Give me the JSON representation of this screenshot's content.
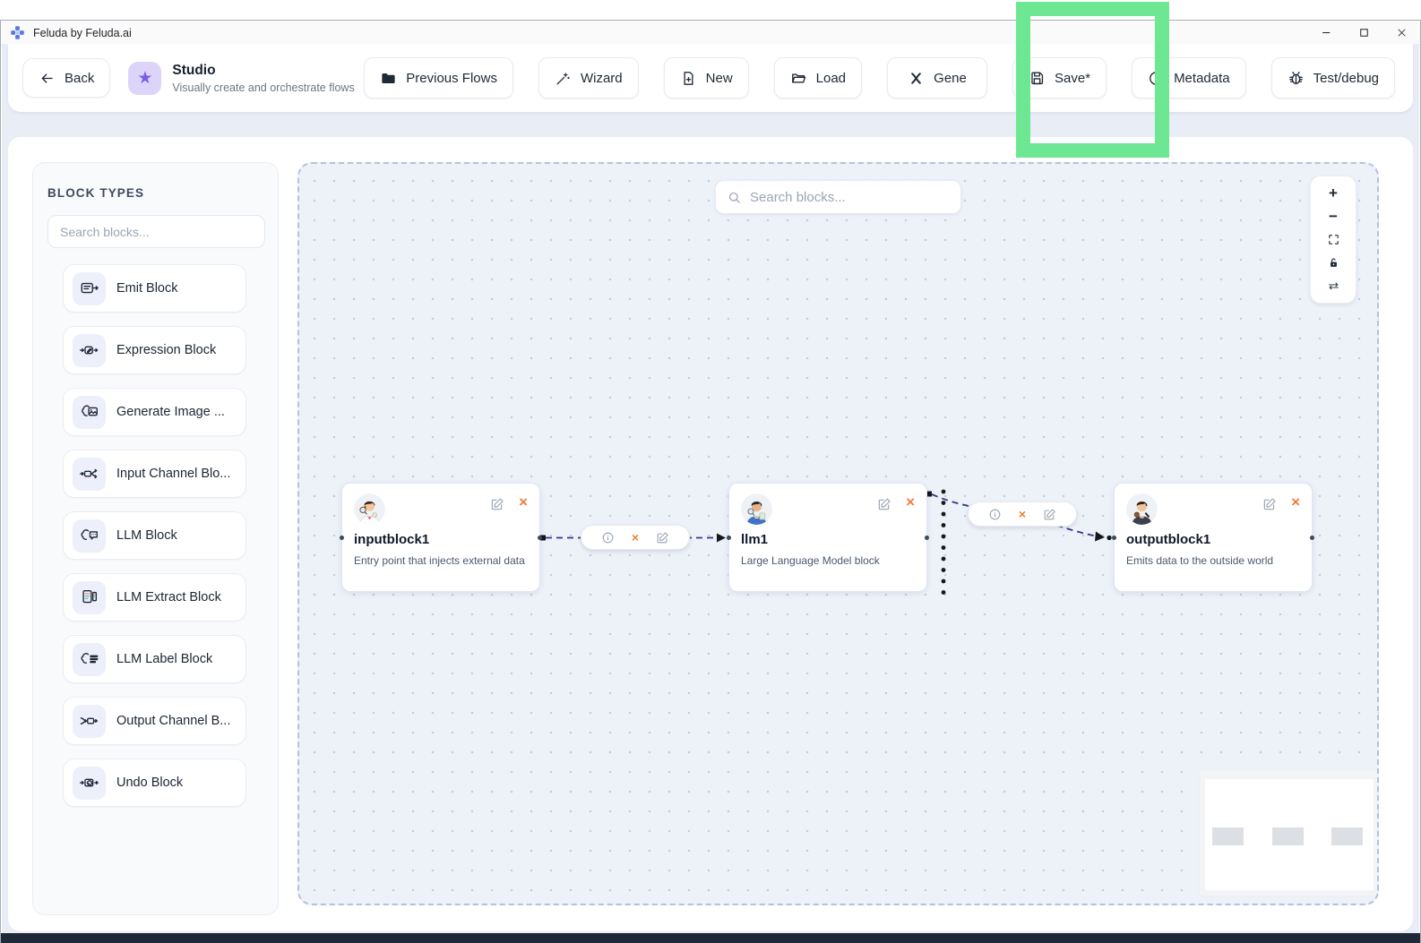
{
  "window": {
    "title": "Feluda by Feluda.ai"
  },
  "header": {
    "back_label": "Back",
    "title": "Studio",
    "subtitle": "Visually create and orchestrate flows",
    "buttons": [
      {
        "label": "Previous Flows",
        "icon": "folder-icon"
      },
      {
        "label": "Wizard",
        "icon": "wand-icon"
      },
      {
        "label": "New",
        "icon": "file-plus-icon"
      },
      {
        "label": "Load",
        "icon": "folder-open-icon"
      },
      {
        "label": "Gene",
        "icon": "generate-icon"
      },
      {
        "label": "Save*",
        "icon": "save-icon"
      },
      {
        "label": "Metadata",
        "icon": "info-icon"
      },
      {
        "label": "Test/debug",
        "icon": "bug-icon"
      }
    ]
  },
  "sidebar": {
    "title": "BLOCK TYPES",
    "search_placeholder": "Search blocks...",
    "items": [
      {
        "label": "Emit Block",
        "icon": "emit-icon"
      },
      {
        "label": "Expression Block",
        "icon": "expression-icon"
      },
      {
        "label": "Generate Image ...",
        "icon": "generate-image-icon"
      },
      {
        "label": "Input Channel Blo...",
        "icon": "input-channel-icon"
      },
      {
        "label": "LLM Block",
        "icon": "llm-icon"
      },
      {
        "label": "LLM Extract Block",
        "icon": "llm-extract-icon"
      },
      {
        "label": "LLM Label Block",
        "icon": "llm-label-icon"
      },
      {
        "label": "Output Channel B...",
        "icon": "output-channel-icon"
      },
      {
        "label": "Undo Block",
        "icon": "undo-icon"
      }
    ]
  },
  "canvas": {
    "search_placeholder": "Search blocks...",
    "nodes": [
      {
        "id": "inputblock1",
        "description": "Entry point that injects external data"
      },
      {
        "id": "llm1",
        "description": "Large Language Model block"
      },
      {
        "id": "outputblock1",
        "description": "Emits data to the outside world"
      }
    ],
    "close_glyph": "×"
  },
  "annotation": {
    "highlighted_button": "Save*",
    "highlight_color": "#6ee793"
  },
  "colors": {
    "edge": "#303a85",
    "close": "#ee7e3c",
    "canvas_bg": "#edf1f8",
    "accent": "#7c5ce6"
  }
}
